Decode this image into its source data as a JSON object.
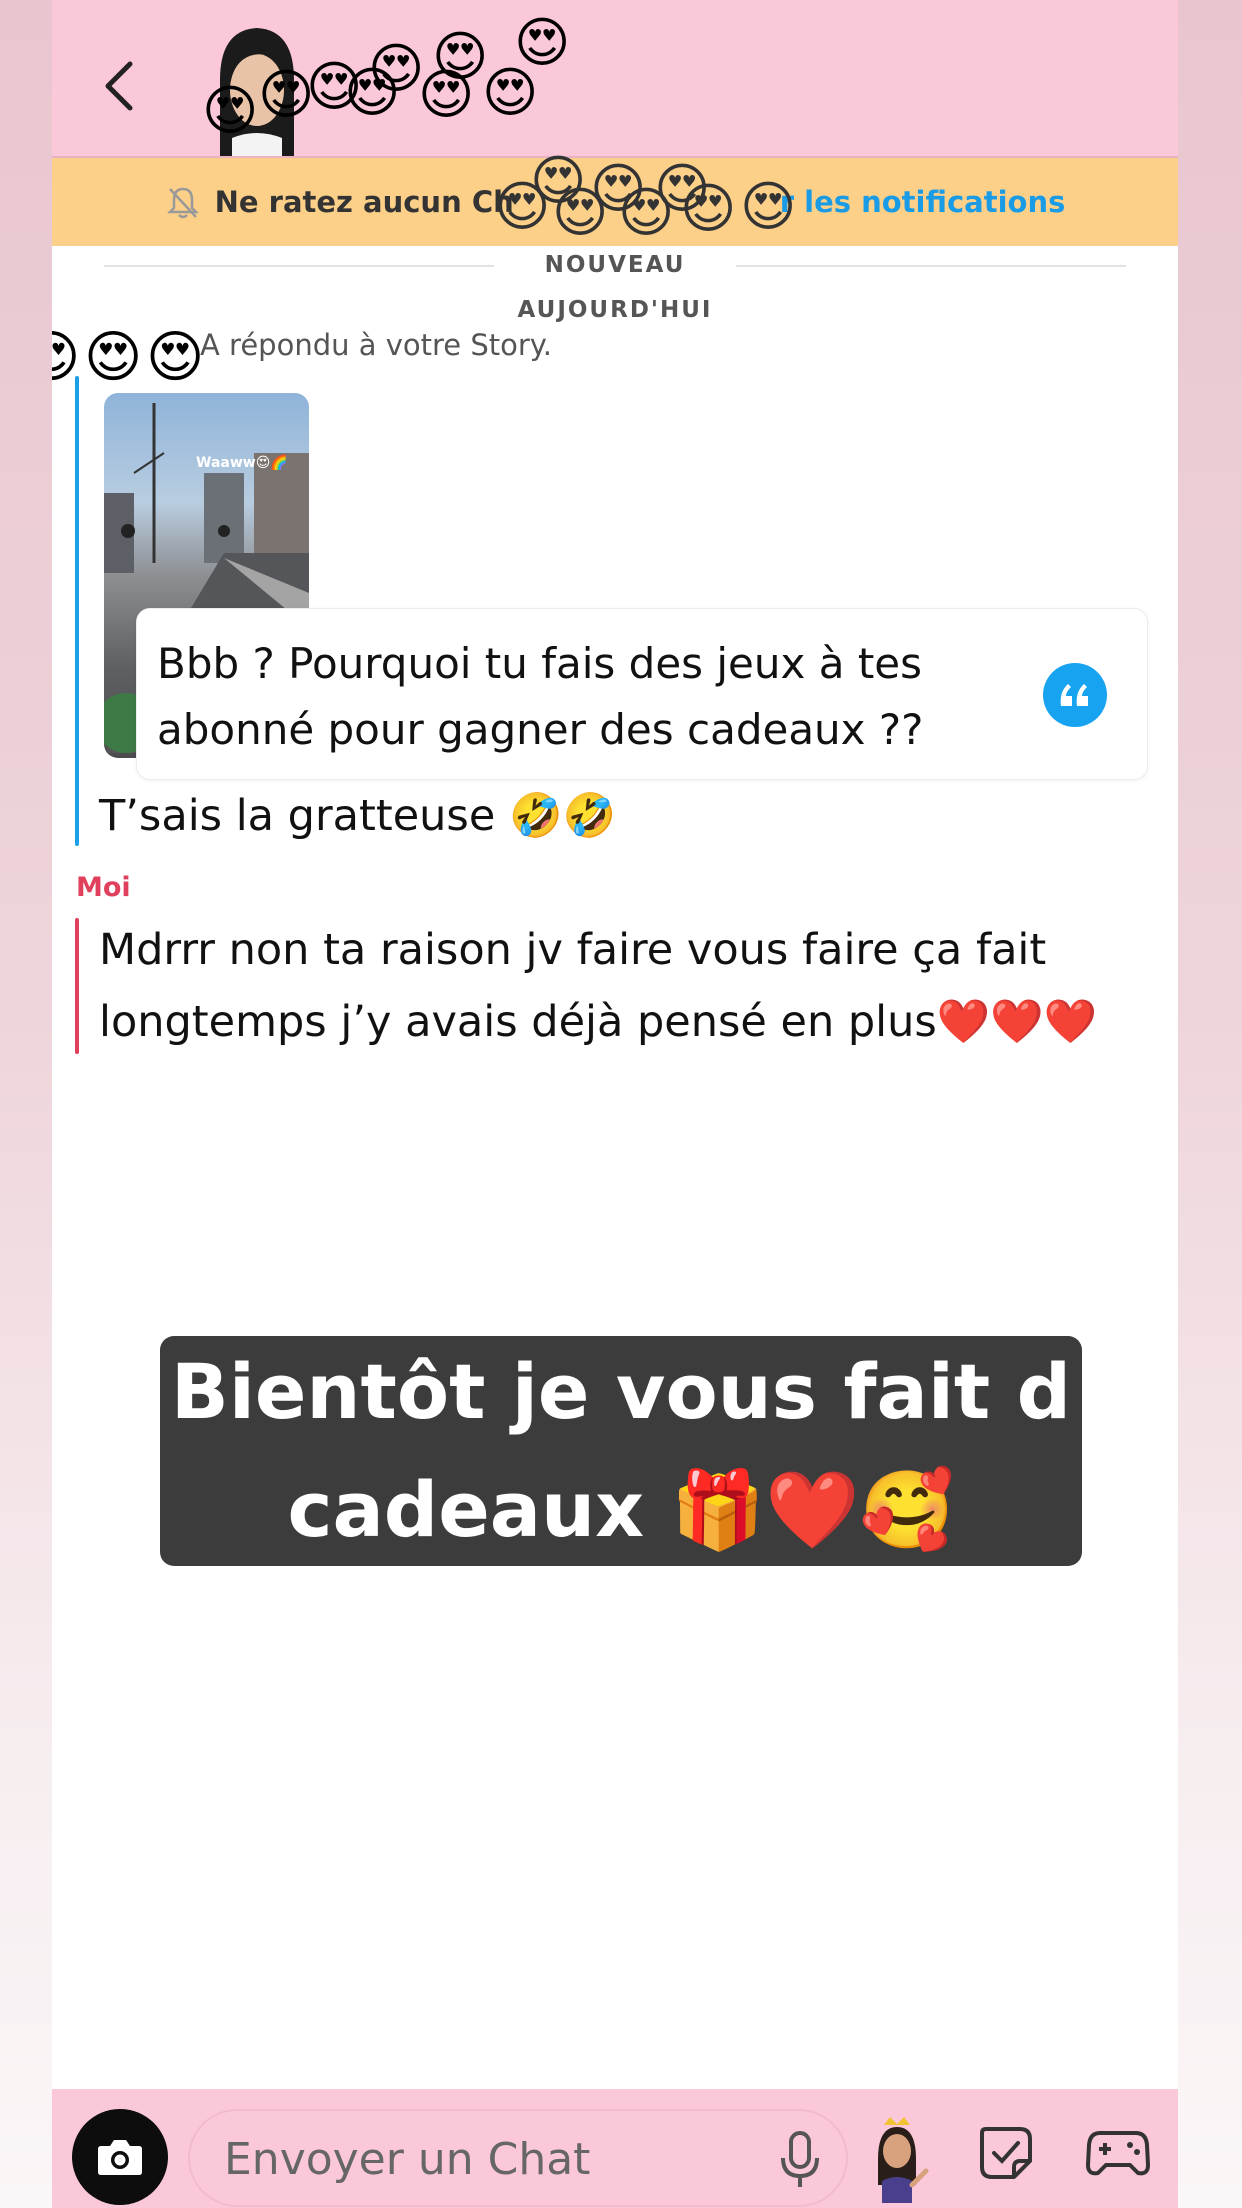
{
  "header": {
    "back_icon": "chevron-left-icon",
    "avatar_icon": "bitmoji-avatar-icon",
    "sticker_emoji": "😍"
  },
  "banner": {
    "text": "Ne ratez aucun Ch",
    "link": "r les notifications",
    "icon": "bell-muted-icon",
    "emoji": "😍"
  },
  "chat": {
    "new_label": "NOUVEAU",
    "date_label": "AUJOURD'HUI",
    "reply_note": "A répondu à votre Story.",
    "story_caption": "Waaww😍🌈",
    "quote_text": "Bbb ? Pourquoi tu fais des jeux à tes abonné pour gagner des cadeaux ??",
    "friend_message": "T’sais la gratteuse 🤣🤣",
    "me_label": "Moi",
    "my_message_line1": "Mdrrr non ta raison jv faire vous faire ça fait",
    "my_message_line2": "longtemps j’y avais déjà pensé en plus❤️❤️❤️",
    "friend_color": "#1aa0e8",
    "me_color": "#e0405c"
  },
  "overlay": {
    "line1": "Bientôt je vous fait d",
    "line2": "cadeaux 🎁❤️🥰"
  },
  "bottom": {
    "input_placeholder": "Envoyer un Chat",
    "camera_icon": "camera-icon",
    "mic_icon": "microphone-icon",
    "bitmoji_icon": "bitmoji-icon",
    "sticker_icon": "sticker-icon",
    "game_icon": "game-controller-icon"
  },
  "colors": {
    "header_bg": "#fbc8d9",
    "banner_bg": "#fdd089",
    "link_blue": "#1a9be6"
  }
}
